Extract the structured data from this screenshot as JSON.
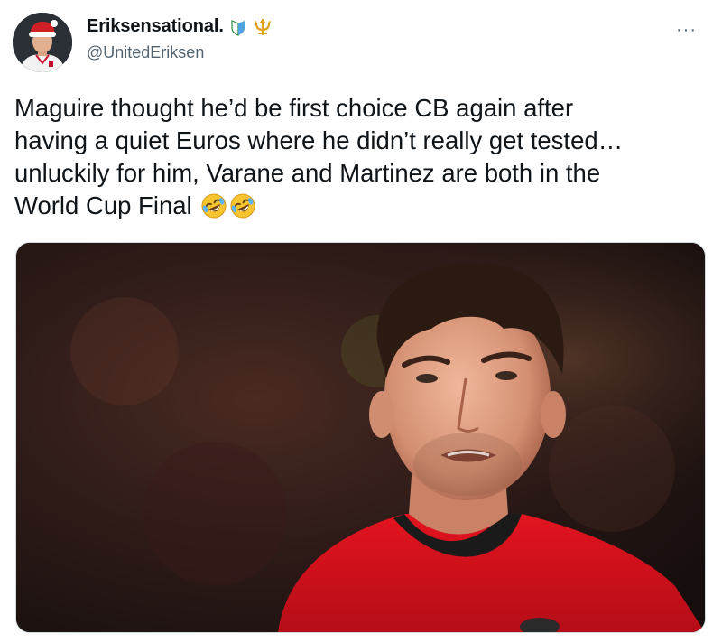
{
  "tweet": {
    "author": {
      "display_name": "Eriksensational.",
      "handle": "@UnitedEriksen",
      "avatar_icon": "profile-avatar",
      "badges": [
        "shield-icon",
        "trident-icon"
      ]
    },
    "more_label": "···",
    "text": "Maguire thought he’d be first choice CB again after\nhaving a quiet Euros where he didn’t really get tested…\nunluckily for him, Varane and Martinez are both in the\nWorld Cup Final",
    "emojis": [
      "rolling-on-floor-laughing",
      "rolling-on-floor-laughing"
    ],
    "media": {
      "type": "photo",
      "icon": "player-photo"
    }
  },
  "colors": {
    "text": "#0f1419",
    "secondary_text": "#536471",
    "border": "#cfd9de",
    "shirt_red": "#d4101b"
  }
}
